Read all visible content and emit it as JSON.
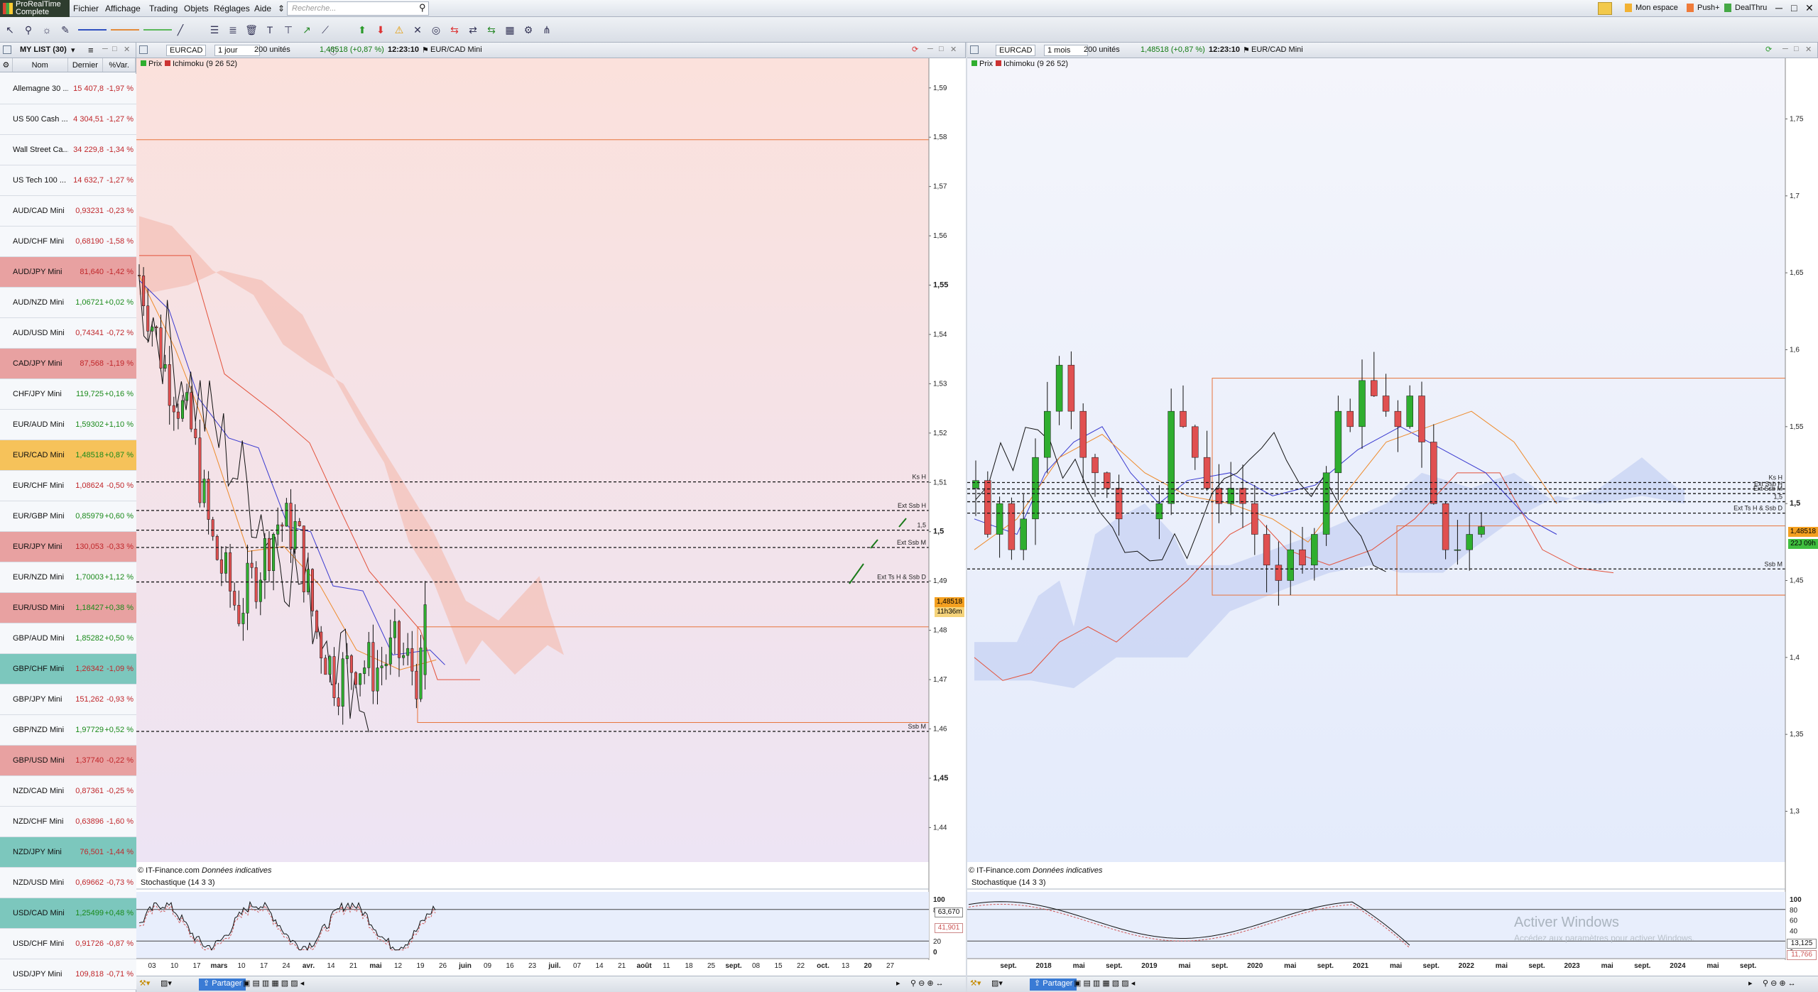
{
  "app": {
    "logo_line1": "ProRealTime",
    "logo_line2": "Complete"
  },
  "menu": [
    "Fichier",
    "Affichage",
    "Trading",
    "Objets",
    "Réglages",
    "Aide"
  ],
  "search": {
    "placeholder": "Recherche..."
  },
  "top_right": {
    "space": "Mon espace",
    "push": "Push+",
    "dealthru": "DealThru"
  },
  "watchlist": {
    "title": "MY LIST (30)",
    "columns": [
      "Nom",
      "Dernier",
      "%Var."
    ],
    "rows": [
      {
        "name": "Allemagne 30 ...",
        "last": "15 407,8",
        "var": "-1,97 %",
        "bg": "#f6f8fb",
        "neg": true
      },
      {
        "name": "US 500 Cash ...",
        "last": "4 304,51",
        "var": "-1,27 %",
        "bg": "#f6f8fb",
        "neg": true
      },
      {
        "name": "Wall Street Ca...",
        "last": "34 229,8",
        "var": "-1,34 %",
        "bg": "#f6f8fb",
        "neg": true
      },
      {
        "name": "US Tech 100 ...",
        "last": "14 632,7",
        "var": "-1,27 %",
        "bg": "#f6f8fb",
        "neg": true
      },
      {
        "name": "AUD/CAD Mini",
        "last": "0,93231",
        "var": "-0,23 %",
        "bg": "#f6f8fb",
        "neg": true
      },
      {
        "name": "AUD/CHF Mini",
        "last": "0,68190",
        "var": "-1,58 %",
        "bg": "#f6f8fb",
        "neg": true
      },
      {
        "name": "AUD/JPY Mini",
        "last": "81,640",
        "var": "-1,42 %",
        "bg": "#e8a1a1",
        "neg": true
      },
      {
        "name": "AUD/NZD Mini",
        "last": "1,06721",
        "var": "+0,02 %",
        "bg": "#f6f8fb",
        "neg": false
      },
      {
        "name": "AUD/USD Mini",
        "last": "0,74341",
        "var": "-0,72 %",
        "bg": "#f6f8fb",
        "neg": true
      },
      {
        "name": "CAD/JPY Mini",
        "last": "87,568",
        "var": "-1,19 %",
        "bg": "#e8a1a1",
        "neg": true
      },
      {
        "name": "CHF/JPY Mini",
        "last": "119,725",
        "var": "+0,16 %",
        "bg": "#f6f8fb",
        "neg": false
      },
      {
        "name": "EUR/AUD Mini",
        "last": "1,59302",
        "var": "+1,10 %",
        "bg": "#f6f8fb",
        "neg": false
      },
      {
        "name": "EUR/CAD Mini",
        "last": "1,48518",
        "var": "+0,87 %",
        "bg": "#f6c25a",
        "neg": false
      },
      {
        "name": "EUR/CHF Mini",
        "last": "1,08624",
        "var": "-0,50 %",
        "bg": "#f6f8fb",
        "neg": true
      },
      {
        "name": "EUR/GBP Mini",
        "last": "0,85979",
        "var": "+0,60 %",
        "bg": "#f6f8fb",
        "neg": false
      },
      {
        "name": "EUR/JPY Mini",
        "last": "130,053",
        "var": "-0,33 %",
        "bg": "#e8a1a1",
        "neg": true
      },
      {
        "name": "EUR/NZD Mini",
        "last": "1,70003",
        "var": "+1,12 %",
        "bg": "#f6f8fb",
        "neg": false
      },
      {
        "name": "EUR/USD Mini",
        "last": "1,18427",
        "var": "+0,38 %",
        "bg": "#e8a1a1",
        "neg": false
      },
      {
        "name": "GBP/AUD Mini",
        "last": "1,85282",
        "var": "+0,50 %",
        "bg": "#f6f8fb",
        "neg": false
      },
      {
        "name": "GBP/CHF Mini",
        "last": "1,26342",
        "var": "-1,09 %",
        "bg": "#7cc7bd",
        "neg": true
      },
      {
        "name": "GBP/JPY Mini",
        "last": "151,262",
        "var": "-0,93 %",
        "bg": "#f6f8fb",
        "neg": true
      },
      {
        "name": "GBP/NZD Mini",
        "last": "1,97729",
        "var": "+0,52 %",
        "bg": "#f6f8fb",
        "neg": false
      },
      {
        "name": "GBP/USD Mini",
        "last": "1,37740",
        "var": "-0,22 %",
        "bg": "#e8a1a1",
        "neg": true
      },
      {
        "name": "NZD/CAD Mini",
        "last": "0,87361",
        "var": "-0,25 %",
        "bg": "#f6f8fb",
        "neg": true
      },
      {
        "name": "NZD/CHF Mini",
        "last": "0,63896",
        "var": "-1,60 %",
        "bg": "#f6f8fb",
        "neg": true
      },
      {
        "name": "NZD/JPY Mini",
        "last": "76,501",
        "var": "-1,44 %",
        "bg": "#7cc7bd",
        "neg": true
      },
      {
        "name": "NZD/USD Mini",
        "last": "0,69662",
        "var": "-0,73 %",
        "bg": "#f6f8fb",
        "neg": true
      },
      {
        "name": "USD/CAD Mini",
        "last": "1,25499",
        "var": "+0,48 %",
        "bg": "#7cc7bd",
        "neg": false
      },
      {
        "name": "USD/CHF Mini",
        "last": "0,91726",
        "var": "-0,87 %",
        "bg": "#f6f8fb",
        "neg": true
      },
      {
        "name": "USD/JPY Mini",
        "last": "109,818",
        "var": "-0,71 %",
        "bg": "#f6f8fb",
        "neg": true
      }
    ]
  },
  "chart_left": {
    "symbol": "EURCAD",
    "period": "1 jour",
    "units": "200 unités",
    "quote": "1,48518 (+0,87 %)",
    "time": "12:23:10",
    "instrument": "EUR/CAD Mini",
    "legend_price": "Prix",
    "legend_ichimoku": "Ichimoku (9 26 52)",
    "credit": "© IT-Finance.com",
    "credit_note": "Données indicatives",
    "stoch_label": "Stochastique (14 3 3)",
    "price_badge": "1,48518",
    "countdown": "11h36m",
    "stoch_value1": "63,670",
    "stoch_value2": "41,901",
    "y_ticks": [
      "1,59",
      "1,58",
      "1,57",
      "1,56",
      "1,55",
      "1,54",
      "1,53",
      "1,52",
      "1,51",
      "1,5",
      "1,49",
      "1,48",
      "1,47",
      "1,46",
      "1,45",
      "1,44"
    ],
    "stoch_ticks": [
      "100",
      "80",
      "20",
      "0"
    ],
    "x_labels": [
      "03",
      "10",
      "17",
      "mars",
      "10",
      "17",
      "24",
      "avr.",
      "14",
      "21",
      "mai",
      "12",
      "19",
      "26",
      "juin",
      "09",
      "16",
      "23",
      "juil.",
      "07",
      "14",
      "21",
      "août",
      "11",
      "18",
      "25",
      "sept.",
      "08",
      "15",
      "22",
      "oct.",
      "13",
      "20",
      "27"
    ],
    "levels": [
      {
        "label": "Ks H",
        "value": 1.5101
      },
      {
        "label": "Ext Ssb H",
        "value": 1.5043
      },
      {
        "label": "1,5",
        "value": 1.5003
      },
      {
        "label": "Ext Ssb M",
        "value": 1.4968
      },
      {
        "label": "Ext Ts H & Ssb D",
        "value": 1.4898
      },
      {
        "label": "Ssb M",
        "value": 1.4595
      }
    ],
    "orange_line": 1.5795
  },
  "chart_right": {
    "symbol": "EURCAD",
    "period": "1 mois",
    "units": "200 unités",
    "quote": "1,48518 (+0,87 %)",
    "time": "12:23:10",
    "instrument": "EUR/CAD Mini",
    "legend_price": "Prix",
    "legend_ichimoku": "Ichimoku (9 26 52)",
    "credit": "© IT-Finance.com",
    "credit_note": "Données indicatives",
    "stoch_label": "Stochastique (14 3 3)",
    "price_badge": "1,48518",
    "countdown": "22J 09h",
    "stoch_value": "13,125",
    "stoch_value2": "11,766",
    "y_ticks": [
      "1,75",
      "1,7",
      "1,65",
      "1,6",
      "1,55",
      "1,5",
      "1,45",
      "1,4",
      "1,35",
      "1,3"
    ],
    "stoch_ticks": [
      "100",
      "80",
      "60",
      "40",
      "20",
      "0"
    ],
    "x_labels": [
      "sept.",
      "2018",
      "mai",
      "sept.",
      "2019",
      "mai",
      "sept.",
      "2020",
      "mai",
      "sept.",
      "2021",
      "mai",
      "sept.",
      "2022",
      "mai",
      "sept.",
      "2023",
      "mai",
      "sept.",
      "2024",
      "mai",
      "sept."
    ],
    "levels": [
      {
        "label": "Ks H",
        "value": 1.5137
      },
      {
        "label": "Ext Ssb H",
        "value": 1.5095
      },
      {
        "label": "Ext Ssb M",
        "value": 1.5065
      },
      {
        "label": "1,5",
        "value": 1.5012
      },
      {
        "label": "Ext Ts H & Ssb D",
        "value": 1.4938
      },
      {
        "label": "Ssb M",
        "value": 1.4575
      }
    ]
  },
  "footer": {
    "share": "Partager"
  },
  "windows_watermark": {
    "title": "Activer Windows",
    "subtitle": "Accédez aux paramètres pour activer Windows."
  },
  "colors": {
    "up": "#2fae2f",
    "down": "#e05050",
    "kijun": "#e3523b",
    "tenkan": "#3a3ad0",
    "chikou": "#111111",
    "cloud_red": "#f4c9c3",
    "cloud_blue": "#c9d3f2"
  }
}
